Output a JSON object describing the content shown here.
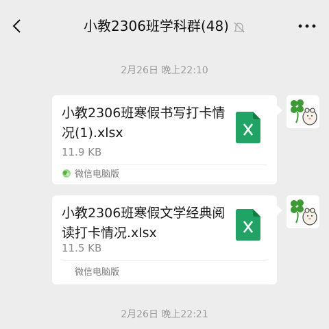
{
  "header": {
    "title": "小教2306班学科群(48)",
    "back_icon": "chevron-left-icon",
    "mute_icon": "bell-off-icon",
    "more_icon": "more-dots-icon"
  },
  "timestamps": [
    "2月26日 晚上22:10",
    "2月26日 晚上22:21"
  ],
  "messages": [
    {
      "file_name": "小教2306班寒假书写打卡情况(1).xlsx",
      "file_size": "11.9 KB",
      "source": "微信电脑版",
      "file_icon": "excel-file-icon",
      "source_icon": "wechat-pc-icon"
    },
    {
      "file_name": "小教2306班寒假文学经典阅读打卡情况.xlsx",
      "file_size": "11.5 KB",
      "source": "微信电脑版",
      "file_icon": "excel-file-icon"
    }
  ],
  "colors": {
    "background": "#ededed",
    "bubble": "#ffffff",
    "excel_green": "#21a366",
    "excel_dark": "#107c41"
  }
}
